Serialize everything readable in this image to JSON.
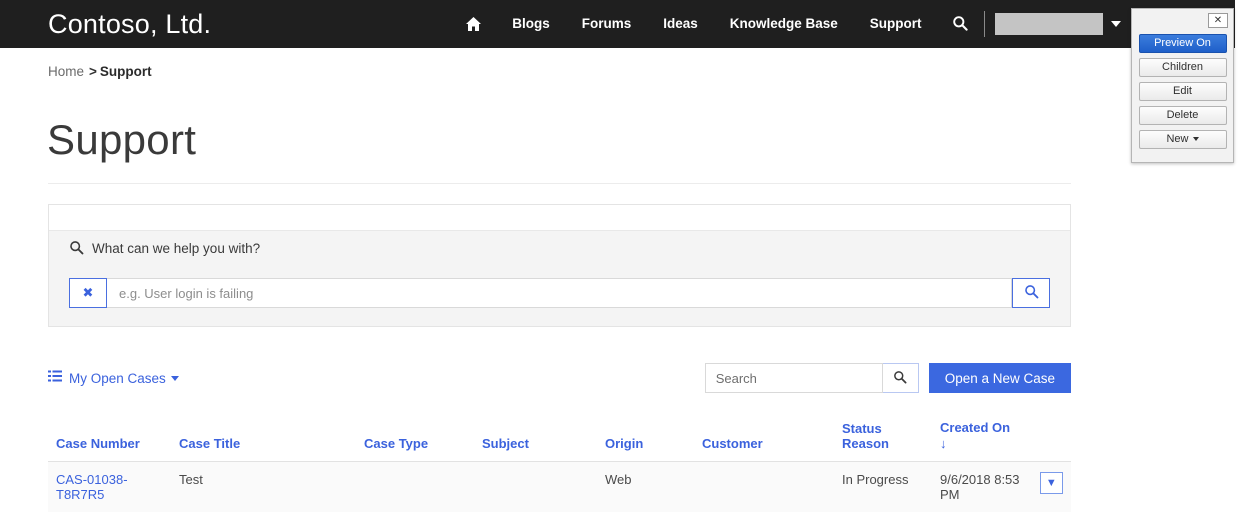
{
  "navbar": {
    "brand": "Contoso, Ltd.",
    "home_icon": "home-icon",
    "links": [
      {
        "label": "Blogs"
      },
      {
        "label": "Forums"
      },
      {
        "label": "Ideas"
      },
      {
        "label": "Knowledge Base"
      },
      {
        "label": "Support"
      }
    ],
    "search_icon": "search-icon",
    "user_menu_label": ""
  },
  "breadcrumb": {
    "home": "Home",
    "separator": ">",
    "current": "Support"
  },
  "page": {
    "title": "Support"
  },
  "help_panel": {
    "heading": "What can we help you with?",
    "heading_icon": "search-icon",
    "clear_label": "✖",
    "input_value": "",
    "input_placeholder": "e.g. User login is failing",
    "search_icon": "search-icon"
  },
  "cases_toolbar": {
    "view_icon": "list-icon",
    "view_label": "My Open Cases",
    "search_value": "",
    "search_placeholder": "Search",
    "search_icon": "search-icon",
    "new_case_label": "Open a New Case"
  },
  "cases_table": {
    "columns": [
      {
        "label": "Case Number",
        "sort": ""
      },
      {
        "label": "Case Title",
        "sort": ""
      },
      {
        "label": "Case Type",
        "sort": ""
      },
      {
        "label": "Subject",
        "sort": ""
      },
      {
        "label": "Origin",
        "sort": ""
      },
      {
        "label": "Customer",
        "sort": ""
      },
      {
        "label": "Status Reason",
        "sort": ""
      },
      {
        "label": "Created On",
        "sort": "↓"
      }
    ],
    "rows": [
      {
        "case_number": "CAS-01038-T8R7R5",
        "case_title": "Test",
        "case_type": "",
        "subject": "",
        "origin": "Web",
        "customer": "",
        "status_reason": "In Progress",
        "created_on": "9/6/2018 8:53 PM",
        "menu_label": "▼"
      }
    ]
  },
  "cms_panel": {
    "close_label": "✕",
    "buttons": [
      {
        "label": "Preview On",
        "active": true,
        "caret": false
      },
      {
        "label": "Children",
        "active": false,
        "caret": false
      },
      {
        "label": "Edit",
        "active": false,
        "caret": false
      },
      {
        "label": "Delete",
        "active": false,
        "caret": false
      },
      {
        "label": "New",
        "active": false,
        "caret": true
      }
    ]
  },
  "colors": {
    "navbar_bg": "#1f1f1f",
    "accent_blue": "#3b62dd",
    "button_blue": "#3b68e0",
    "cms_active_blue": "#2a6fd6",
    "panel_gray": "#f4f4f4",
    "row_gray": "#fafafa"
  }
}
